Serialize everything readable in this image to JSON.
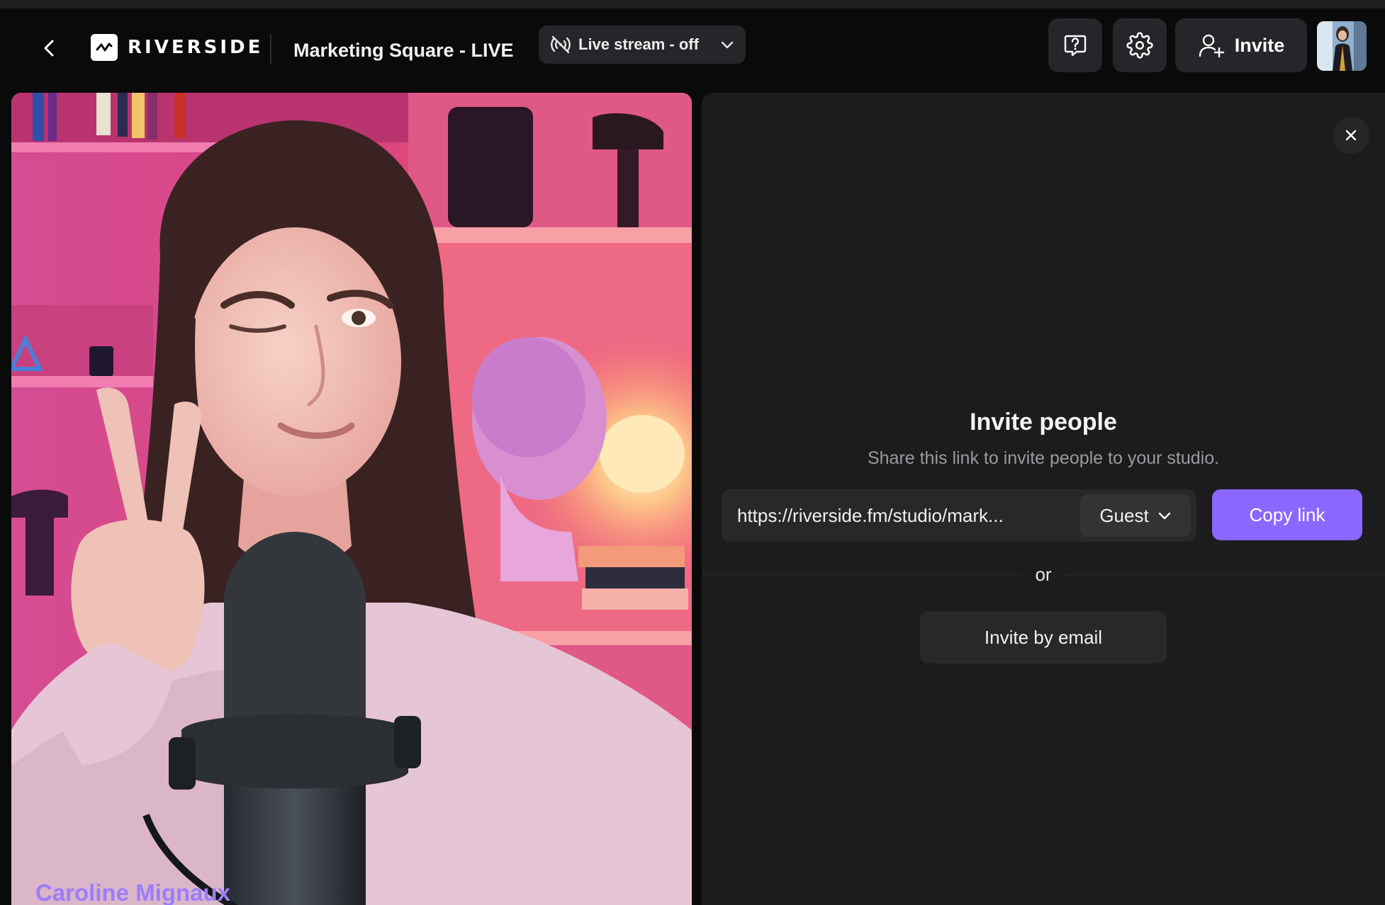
{
  "app": {
    "brand": "RIVERSIDE"
  },
  "header": {
    "studio_title": "Marketing Square - LIVE",
    "live_stream_label": "Live stream - off",
    "invite_label": "Invite"
  },
  "icons": {
    "back": "chevron-left-icon",
    "logo": "riverside-logo-icon",
    "live_stream": "broadcast-off-icon",
    "help": "help-chat-icon",
    "settings": "gear-icon",
    "invite": "user-plus-icon",
    "close": "close-icon"
  },
  "video": {
    "participant_name": "Caroline Mignaux"
  },
  "invite_panel": {
    "title": "Invite people",
    "subtitle": "Share this link to invite people to your studio.",
    "link": "https://riverside.fm/studio/mark...",
    "role": "Guest",
    "copy_label": "Copy link",
    "or_label": "or",
    "email_label": "Invite by email"
  },
  "colors": {
    "accent": "#8c67ff",
    "name_tag": "#9b7dff",
    "panel_bg": "#1c1c1e",
    "app_bg": "#0a0a0b"
  }
}
